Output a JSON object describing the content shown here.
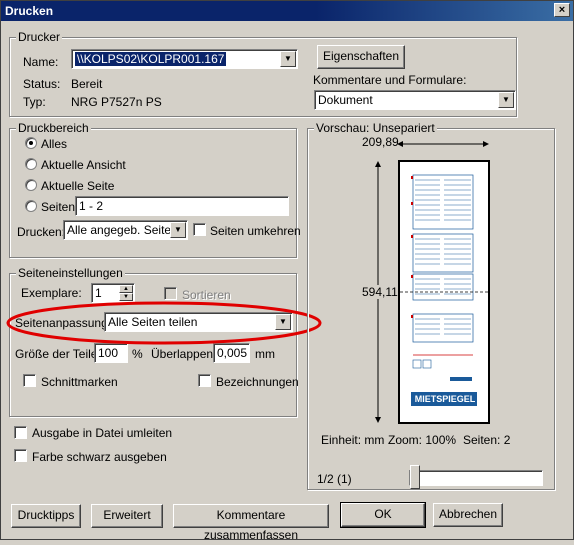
{
  "window": {
    "title": "Drucken",
    "close_glyph": "×"
  },
  "printer": {
    "legend": "Drucker",
    "name_label": "Name:",
    "name_value": "\\\\KOLPS02\\KOLPR001.167",
    "status_label": "Status:",
    "status_value": "Bereit",
    "type_label": "Typ:",
    "type_value": "NRG P7527n PS",
    "properties_button": "Eigenschaften",
    "comments_label": "Kommentare und Formulare:",
    "comments_value": "Dokument"
  },
  "print_range": {
    "legend": "Druckbereich",
    "options": [
      "Alles",
      "Aktuelle Ansicht",
      "Aktuelle Seite",
      "Seiten"
    ],
    "selected": "Alles",
    "pages_value": "1 - 2",
    "print_label": "Drucken:",
    "print_value": "Alle angegeb. Seiten",
    "reverse_label": "Seiten umkehren"
  },
  "page_settings": {
    "legend": "Seiteneinstellungen",
    "copies_label": "Exemplare:",
    "copies_value": "1",
    "collate_label": "Sortieren",
    "scaling_label": "Seitenanpassung:",
    "scaling_value": "Alle Seiten teilen",
    "tile_size_label": "Größe der Teile:",
    "tile_size_value": "100",
    "tile_size_unit": "%",
    "overlap_label": "Überlappen:",
    "overlap_value": "0,005",
    "overlap_unit": "mm",
    "cut_marks_label": "Schnittmarken",
    "labels_label": "Bezeichnungen"
  },
  "output": {
    "print_to_file": "Ausgabe in Datei umleiten",
    "print_black": "Farbe schwarz ausgeben"
  },
  "preview": {
    "legend": "Vorschau: Unsepariert",
    "width": "209,89",
    "height": "594,11",
    "unit": "Einheit: mm",
    "zoom": "Zoom: 100%",
    "pages": "Seiten: 2",
    "page_indicator": "1/2 (1)",
    "logo_text": "MIETSPIEGEL",
    "slider_position": 0.0
  },
  "buttons": {
    "print_tips": "Drucktipps",
    "advanced": "Erweitert",
    "summarize": "Kommentare zusammenfassen",
    "ok": "OK",
    "cancel": "Abbrechen"
  },
  "annotation": {
    "color": "#e00000"
  }
}
